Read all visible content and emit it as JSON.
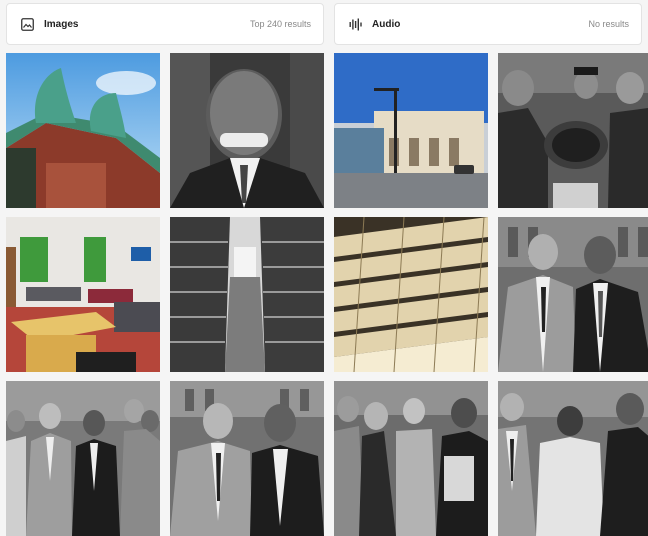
{
  "sections": {
    "images": {
      "title": "Images",
      "count_text": "Top 240 results",
      "icon": "image-icon"
    },
    "audio": {
      "title": "Audio",
      "count_text": "No results",
      "icon": "audio-waveform-icon"
    }
  },
  "colors": {
    "card_background": "#ffffff",
    "card_border": "#e3e3e3",
    "page_background": "#f5f5f5",
    "muted_text": "#888888"
  }
}
